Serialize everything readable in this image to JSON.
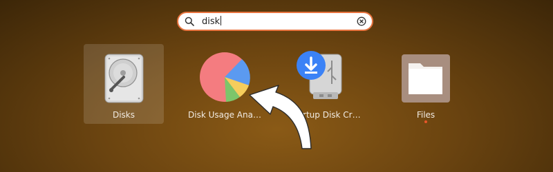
{
  "search": {
    "value": "disk",
    "icon": "search-icon",
    "clear_icon": "clear-icon"
  },
  "apps": [
    {
      "label": "Disks",
      "icon": "disks-icon",
      "selected": true
    },
    {
      "label": "Disk Usage Ana…",
      "icon": "pie-chart-icon",
      "selected": false
    },
    {
      "label": "Startup Disk Cr…",
      "icon": "usb-download-icon",
      "selected": false
    },
    {
      "label": "Files",
      "icon": "folder-icon",
      "selected": false,
      "running": true
    }
  ],
  "colors": {
    "accent": "#e8743f",
    "running_indicator": "#e9572a",
    "pie_red": "#f47c80",
    "pie_blue": "#5b9af0",
    "pie_yellow": "#f6cd5c",
    "pie_green": "#7dc56a",
    "download_blue": "#3b82f6"
  }
}
